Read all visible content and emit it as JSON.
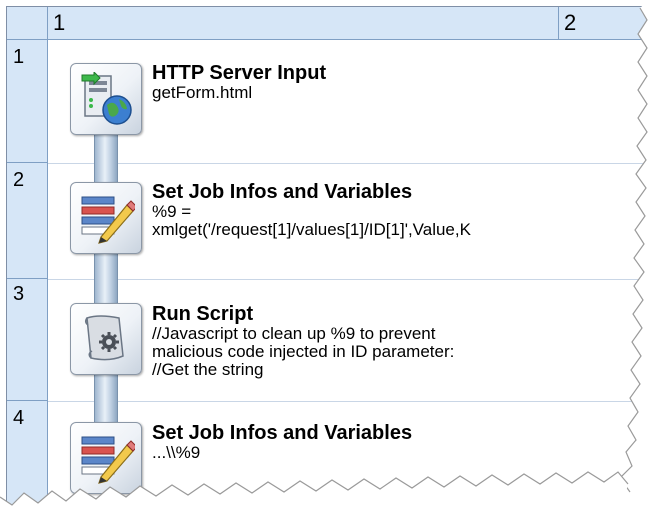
{
  "grid": {
    "columns": [
      "1",
      "2"
    ],
    "rows": [
      "1",
      "2",
      "3",
      "4"
    ]
  },
  "nodes": [
    {
      "title": "HTTP Server Input",
      "detail": [
        "getForm.html"
      ],
      "icon": "http-server-input-icon"
    },
    {
      "title": "Set Job Infos and Variables",
      "detail": [
        "%9 =",
        "xmlget('/request[1]/values[1]/ID[1]',Value,K"
      ],
      "icon": "set-job-infos-icon"
    },
    {
      "title": "Run Script",
      "detail": [
        "//Javascript to clean up %9 to prevent",
        "malicious code injected in ID parameter:",
        "//Get the string"
      ],
      "icon": "run-script-icon"
    },
    {
      "title": "Set Job Infos and Variables",
      "detail": [
        "...\\\\%9"
      ],
      "icon": "set-job-infos-icon"
    }
  ],
  "colors": {
    "header_bg": "#d6e6f7",
    "grid_line": "#7f9fc4",
    "connector": "#9fb6cf"
  }
}
